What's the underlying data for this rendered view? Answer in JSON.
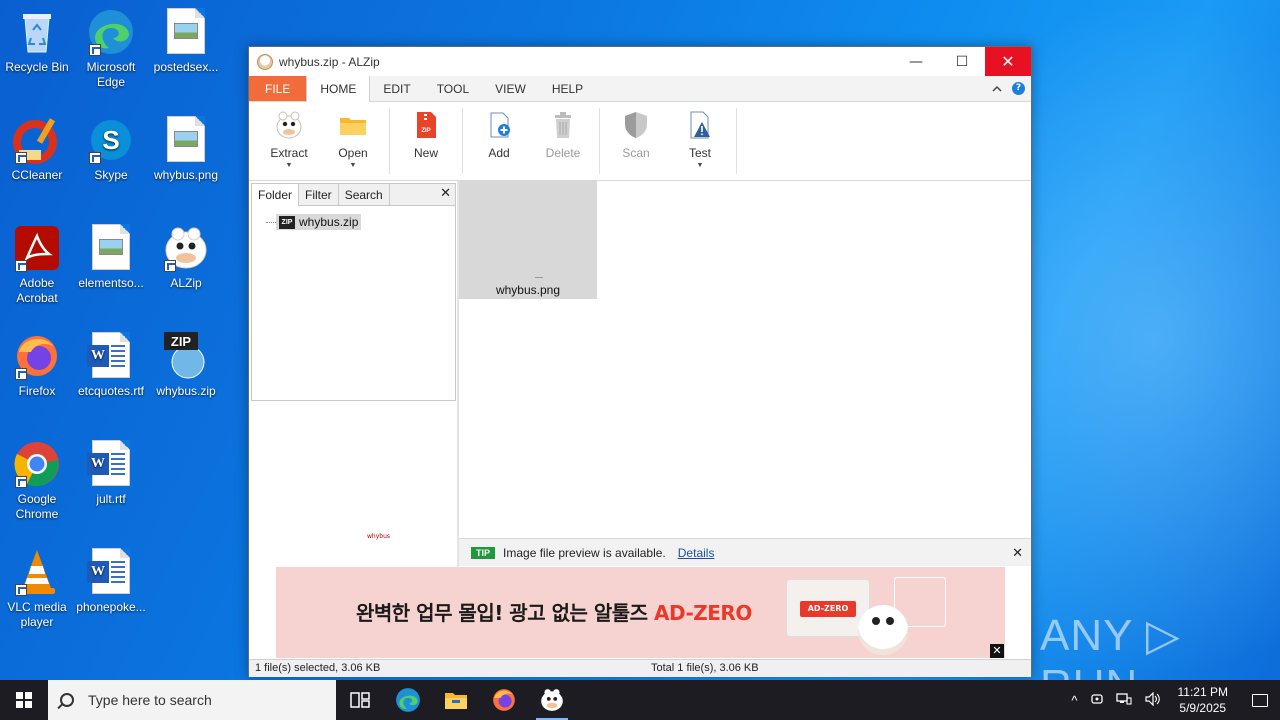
{
  "desktop": {
    "icons": [
      {
        "label": "Recycle Bin"
      },
      {
        "label": "Microsoft Edge"
      },
      {
        "label": "postedsex..."
      },
      {
        "label": "CCleaner"
      },
      {
        "label": "Skype"
      },
      {
        "label": "whybus.png"
      },
      {
        "label": "Adobe Acrobat"
      },
      {
        "label": "elementso..."
      },
      {
        "label": "ALZip"
      },
      {
        "label": "Firefox"
      },
      {
        "label": "etcquotes.rtf"
      },
      {
        "label": "whybus.zip"
      },
      {
        "label": "Google Chrome"
      },
      {
        "label": "jult.rtf"
      },
      {
        "label": "VLC media player"
      },
      {
        "label": "phonepoke..."
      }
    ]
  },
  "window": {
    "title": "whybus.zip - ALZip",
    "minimize_glyph": "—",
    "maximize_glyph": "☐",
    "close_glyph": "✕"
  },
  "menu": {
    "tabs": [
      "FILE",
      "HOME",
      "EDIT",
      "TOOL",
      "VIEW",
      "HELP"
    ],
    "help_glyph": "?"
  },
  "ribbon": {
    "buttons": [
      {
        "label": "Extract",
        "enabled": true,
        "dropdown": true
      },
      {
        "label": "Open",
        "enabled": true,
        "dropdown": true
      },
      {
        "label": "New",
        "enabled": true,
        "dropdown": false
      },
      {
        "label": "Add",
        "enabled": true,
        "dropdown": false
      },
      {
        "label": "Delete",
        "enabled": false,
        "dropdown": false
      },
      {
        "label": "Scan",
        "enabled": false,
        "dropdown": false
      },
      {
        "label": "Test",
        "enabled": true,
        "dropdown": true
      }
    ],
    "zip_icon_text": "ZIP"
  },
  "left_panel": {
    "tabs": [
      "Folder",
      "Filter",
      "Search"
    ],
    "close_glyph": "✕",
    "tree_root": "whybus.zip",
    "zip_badge": "ZIP"
  },
  "preview": {
    "tiny_text": "whybus"
  },
  "files": [
    {
      "name": "whybus.png"
    }
  ],
  "tip": {
    "badge": "TIP",
    "message": "Image file preview is available.",
    "link": "Details",
    "close_glyph": "✕"
  },
  "ad": {
    "text_main": "완벽한 업무 몰입! 광고 없는 알툴즈 ",
    "text_accent": "AD-ZERO",
    "chip": "AD-ZERO",
    "close_glyph": "✕"
  },
  "status": {
    "left": "1 file(s) selected, 3.06 KB",
    "right": "Total 1 file(s), 3.06 KB"
  },
  "watermark": "ANY ▷ RUN",
  "taskbar": {
    "search_placeholder": "Type here to search",
    "time": "11:21 PM",
    "date": "5/9/2025",
    "tray_chevron": "^"
  },
  "colors": {
    "file_tab": "#f26b3a",
    "close_red": "#e81123",
    "tip_green": "#1e9a3c",
    "ad_accent": "#e8392a"
  }
}
